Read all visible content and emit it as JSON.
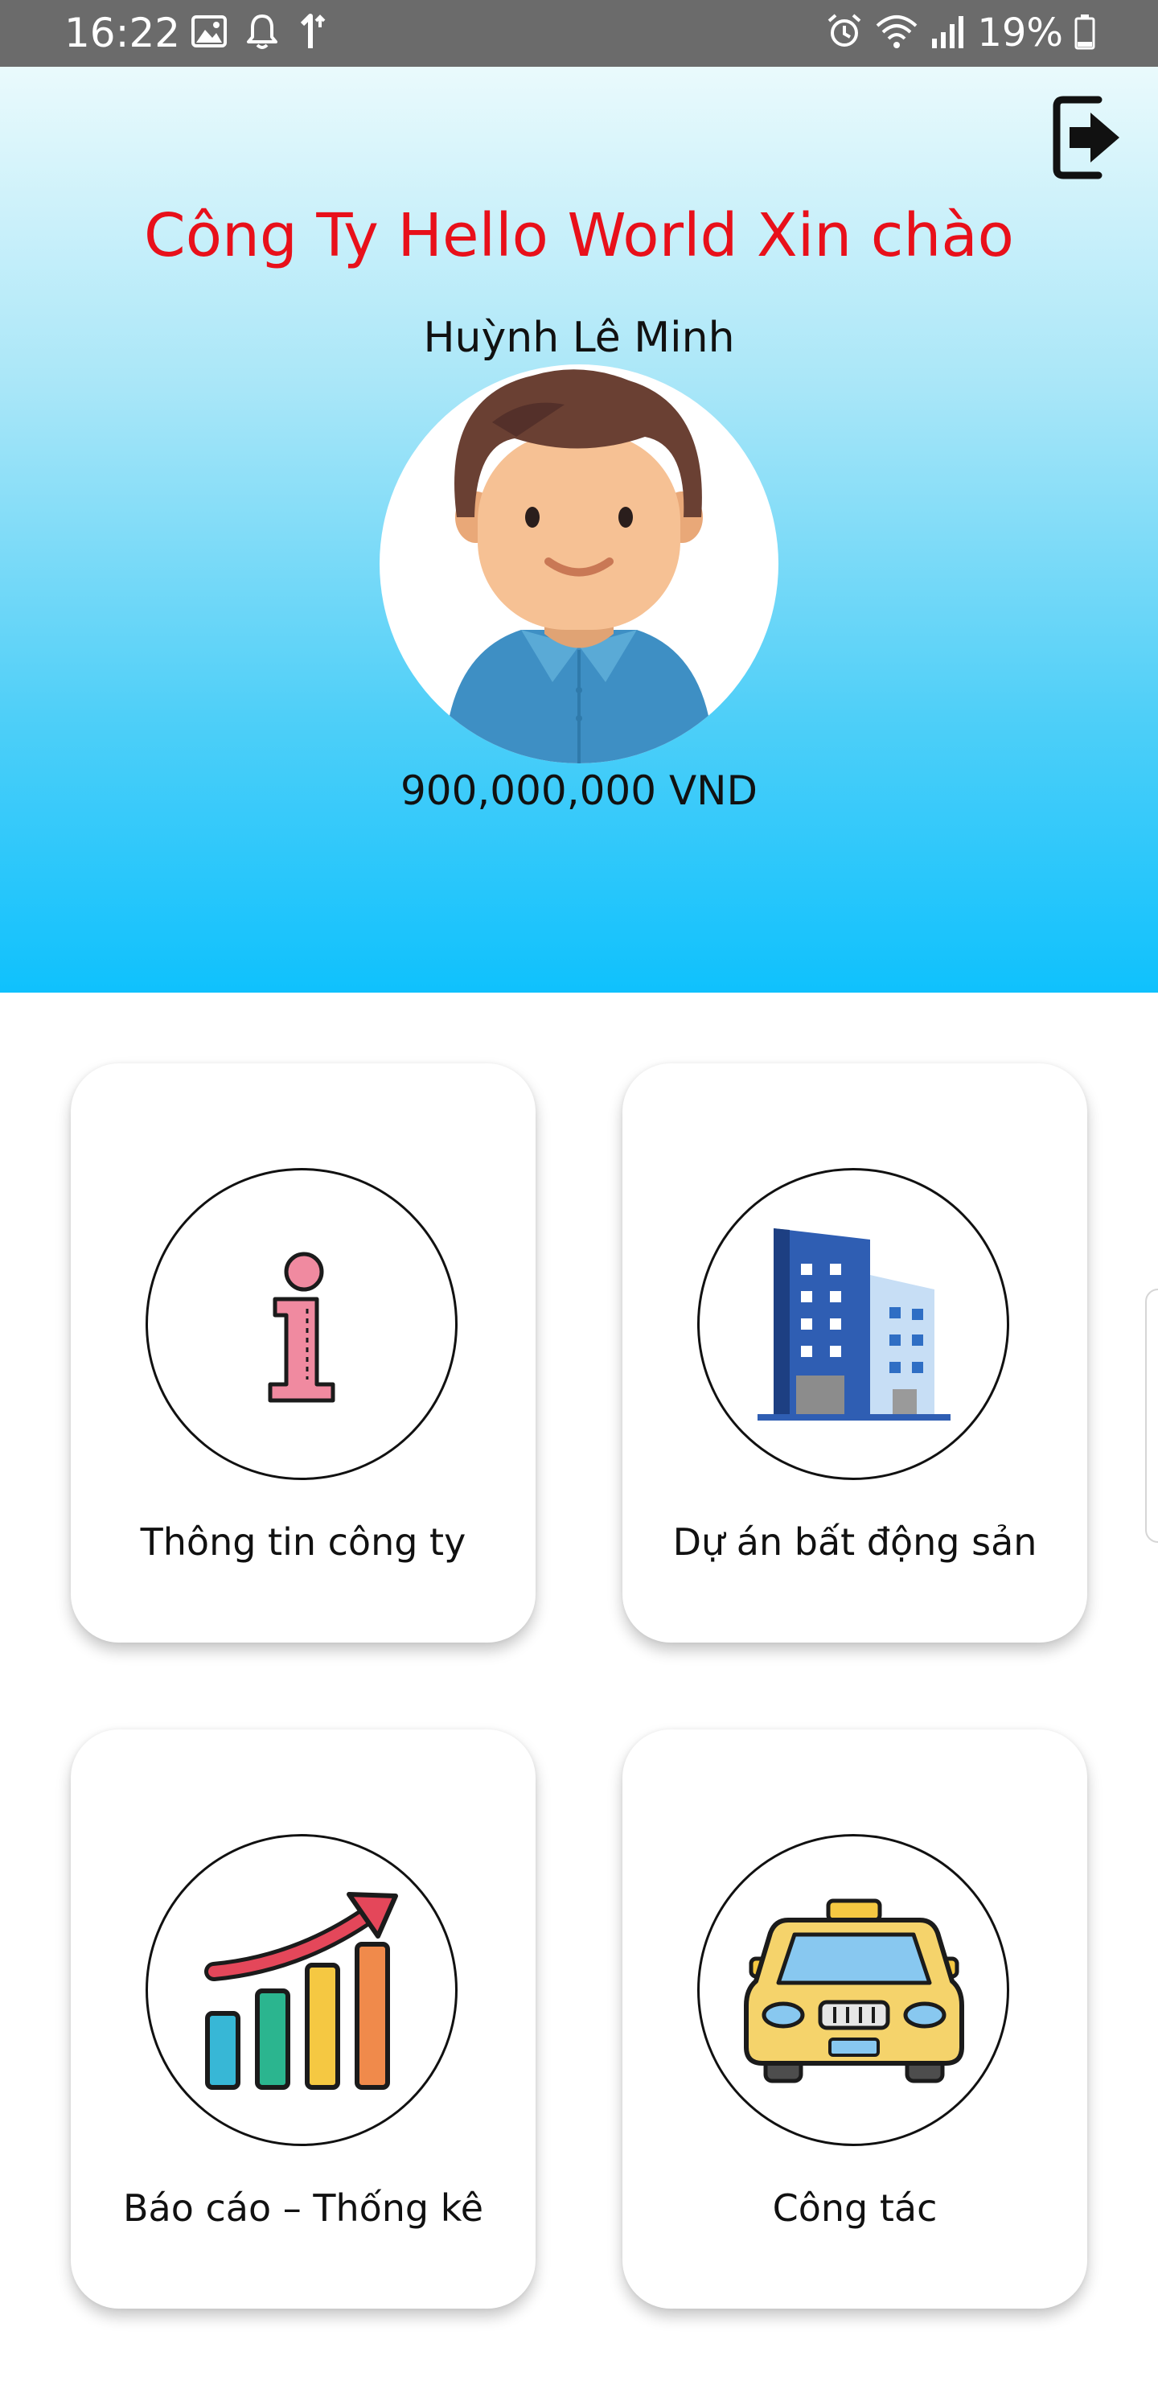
{
  "status_bar": {
    "time": "16:22",
    "battery": "19%",
    "icons_left": [
      "image-icon",
      "bell-icon",
      "data-icon"
    ],
    "icons_right": [
      "alarm-icon",
      "wifi-icon",
      "signal-icon",
      "battery-icon"
    ]
  },
  "header": {
    "title": "Công Ty Hello World Xin chào",
    "user_name": "Huỳnh Lê Minh",
    "balance": "900,000,000 VND",
    "title_color": "#e8101a",
    "gradient_top": "#eafafc",
    "gradient_bottom": "#0fc1fd"
  },
  "menu": {
    "items": [
      {
        "label": "Thông tin công ty",
        "icon": "info-icon"
      },
      {
        "label": "Dự án bất động sản",
        "icon": "buildings-icon"
      },
      {
        "label": "Báo cáo – Thống kê",
        "icon": "bar-chart-icon"
      },
      {
        "label": "Công tác",
        "icon": "taxi-icon"
      }
    ]
  }
}
